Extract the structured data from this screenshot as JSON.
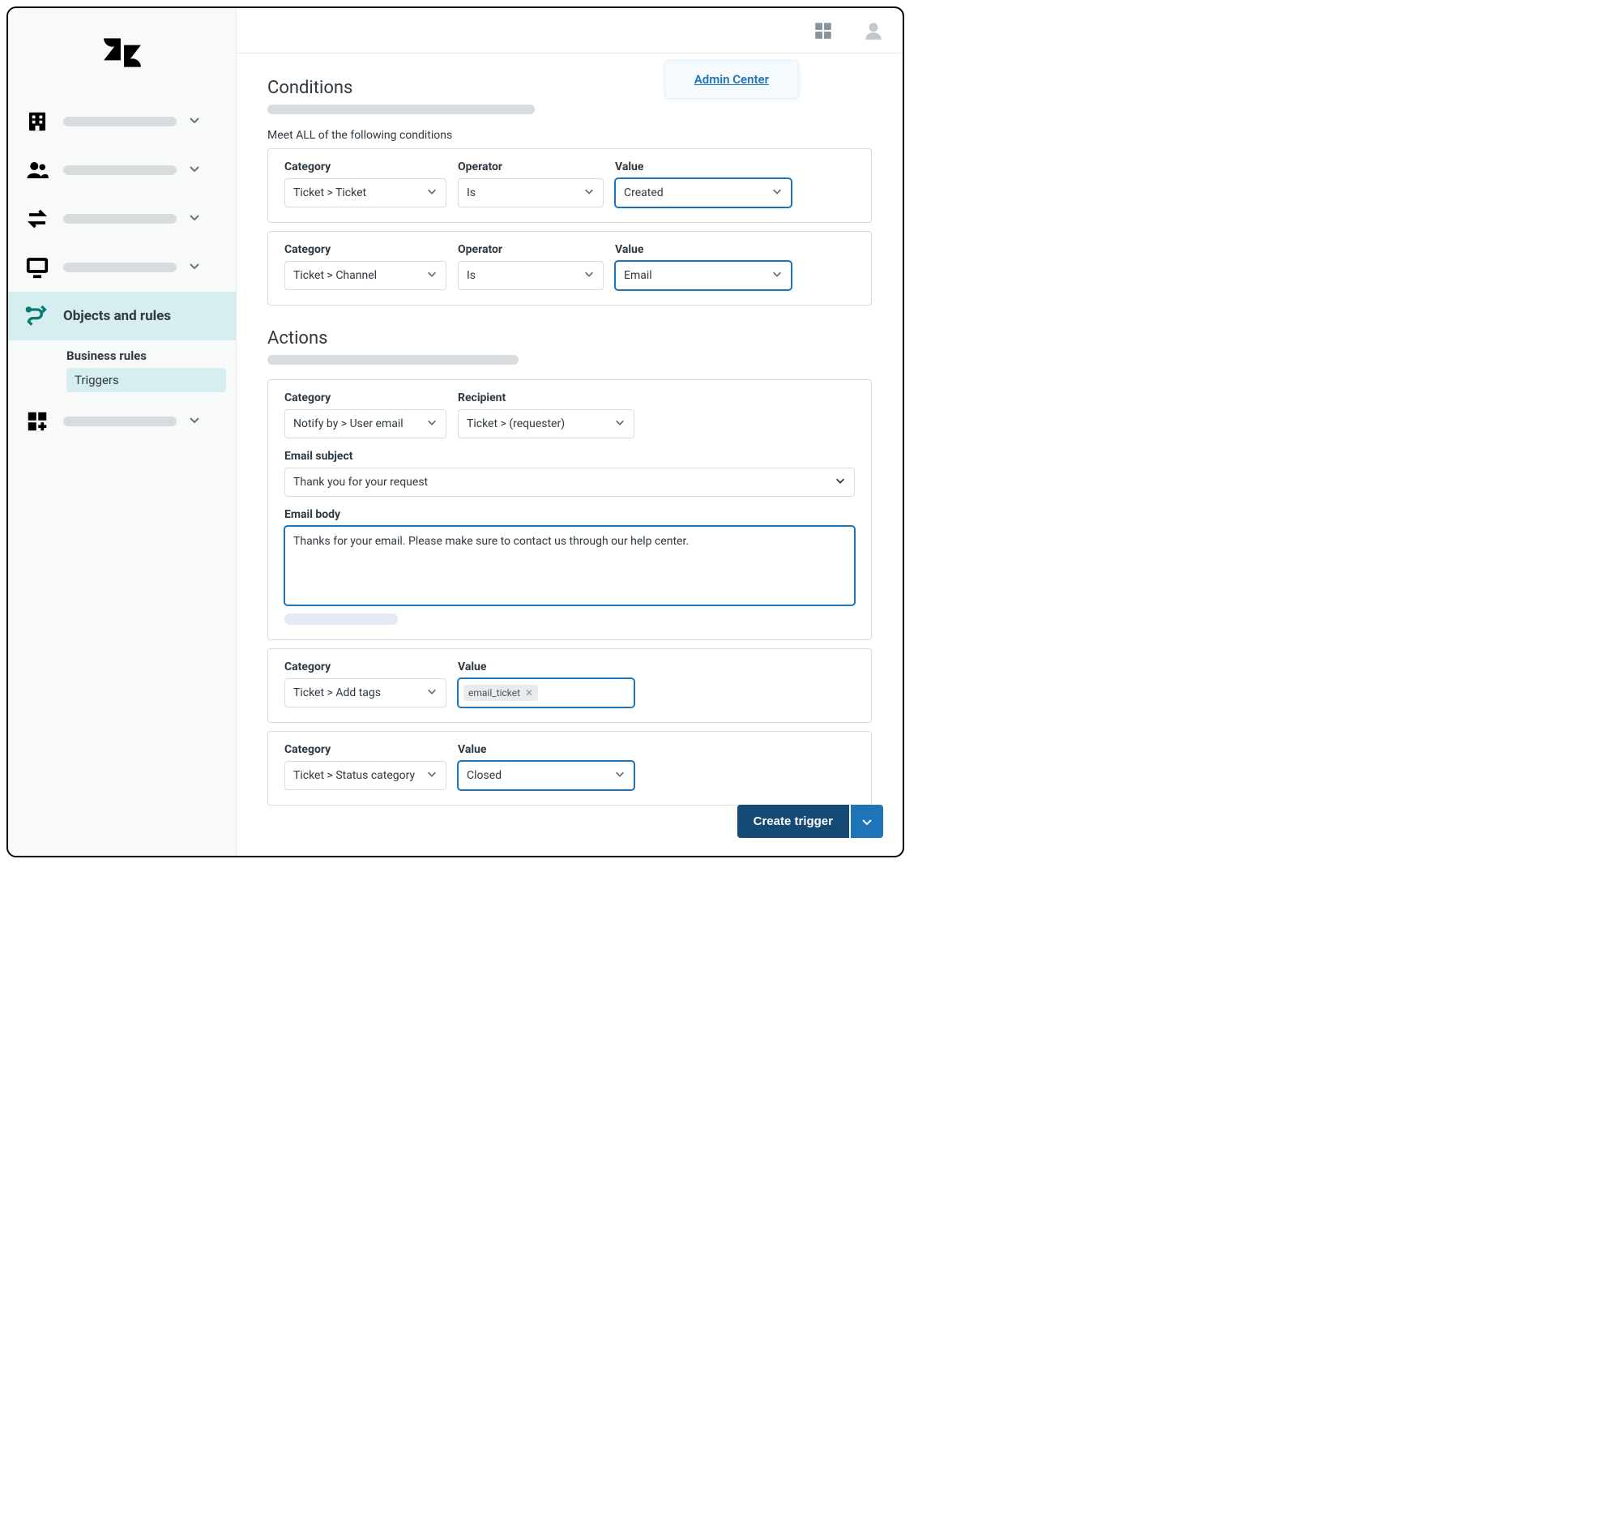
{
  "breadcrumb": {
    "label": "Admin Center"
  },
  "sidebar": {
    "active_label": "Objects and rules",
    "sub_heading": "Business rules",
    "sub_item": "Triggers"
  },
  "conditions": {
    "title": "Conditions",
    "all_label": "Meet ALL of the following conditions",
    "labels": {
      "category": "Category",
      "operator": "Operator",
      "value": "Value"
    },
    "rows": [
      {
        "category": "Ticket > Ticket",
        "operator": "Is",
        "value": "Created"
      },
      {
        "category": "Ticket > Channel",
        "operator": "Is",
        "value": "Email"
      }
    ]
  },
  "actions": {
    "title": "Actions",
    "labels": {
      "category": "Category",
      "recipient": "Recipient",
      "email_subject": "Email subject",
      "email_body": "Email body",
      "value": "Value"
    },
    "notify": {
      "category": "Notify by > User email",
      "recipient": "Ticket > (requester)",
      "subject": "Thank you for your request",
      "body": "Thanks for your email. Please make sure to contact us through our help center."
    },
    "tags": {
      "category": "Ticket > Add tags",
      "tag": "email_ticket"
    },
    "status": {
      "category": "Ticket > Status category",
      "value": "Closed"
    }
  },
  "footer": {
    "create": "Create trigger"
  }
}
